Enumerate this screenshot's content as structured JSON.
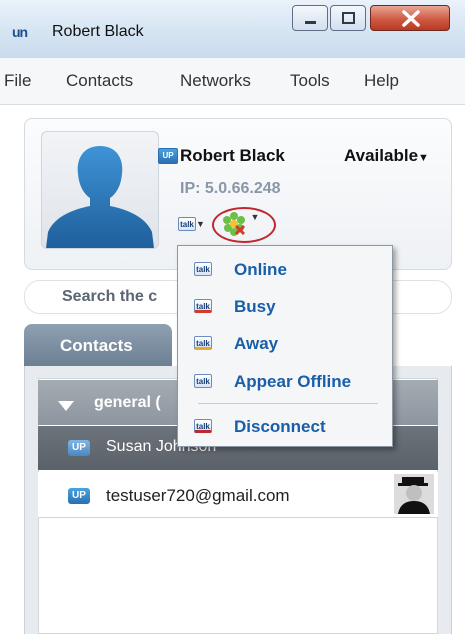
{
  "window": {
    "title": "Robert Black",
    "logo": "un"
  },
  "menu": [
    "File",
    "Contacts",
    "Networks",
    "Tools",
    "Help"
  ],
  "profile": {
    "name": "Robert Black",
    "status": "Available",
    "ip": "IP: 5.0.66.248",
    "badge": "UP"
  },
  "search": {
    "placeholder": "Search the c"
  },
  "tabs": {
    "contacts": "Contacts"
  },
  "contacts": {
    "group": "general (",
    "items": [
      {
        "name": "Susan Johnson",
        "badge": "UP"
      },
      {
        "name": "testuser720@gmail.com",
        "badge": "UP"
      }
    ]
  },
  "status_menu": {
    "items": [
      "Online",
      "Busy",
      "Away",
      "Appear Offline"
    ],
    "disconnect": "Disconnect",
    "icon_text": "talk"
  },
  "colors": {
    "accent": "#1a5ea8",
    "close": "#c94a32",
    "highlight_ring": "#c0282d"
  }
}
